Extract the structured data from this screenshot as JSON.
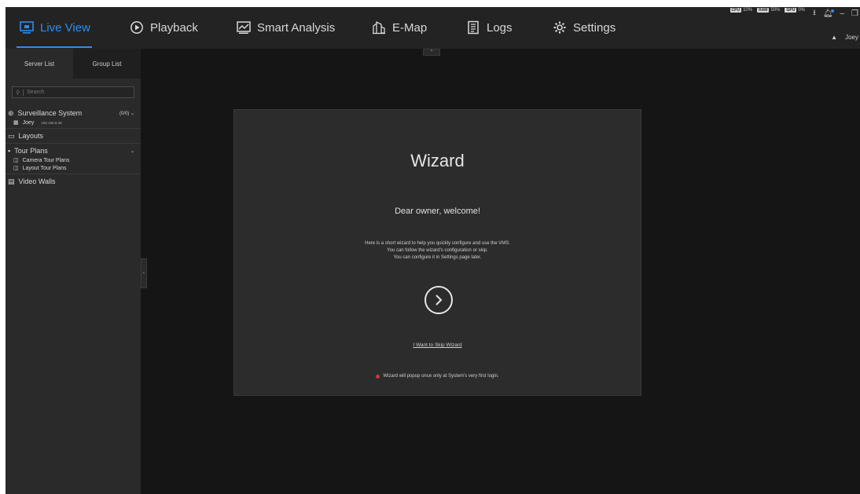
{
  "nav": {
    "tabs": [
      {
        "label": "Live View",
        "icon": "live-view-icon",
        "active": true
      },
      {
        "label": "Playback",
        "icon": "playback-icon",
        "active": false
      },
      {
        "label": "Smart Analysis",
        "icon": "smart-analysis-icon",
        "active": false
      },
      {
        "label": "E-Map",
        "icon": "emap-icon",
        "active": false
      },
      {
        "label": "Logs",
        "icon": "logs-icon",
        "active": false
      },
      {
        "label": "Settings",
        "icon": "settings-icon",
        "active": false
      }
    ],
    "accent_color": "#2e8cf0"
  },
  "status": {
    "cpu_label": "CPU",
    "cpu": "10%",
    "ram_label": "RAM",
    "ram": "50%",
    "gpu_label": "GPU",
    "gpu": "0%"
  },
  "user": {
    "name": "Joey"
  },
  "sidebar": {
    "tabs": [
      "Server List",
      "Group List"
    ],
    "search_placeholder": "Search",
    "tree": {
      "system": {
        "label": "Surveillance System",
        "count": "(0/0)"
      },
      "server": {
        "label": "Joey",
        "ip": "192.168.8.48"
      },
      "layouts": "Layouts",
      "tour_plans": "Tour Plans",
      "camera_tour_plans": "Camera Tour Plans",
      "layout_tour_plans": "Layout Tour Plans",
      "video_walls": "Video Walls"
    }
  },
  "wizard": {
    "title": "Wizard",
    "greeting": "Dear owner, welcome!",
    "desc_line1": "Here is a short wizard to help you quickly configure and use the VMS.",
    "desc_line2": "You can follow the wizard's configuration or skip.",
    "desc_line3": "You can configure it in Settings page later.",
    "skip_link": "I Want to Skip Wizard",
    "note": "Wizard will popup once only at System's very first login."
  }
}
